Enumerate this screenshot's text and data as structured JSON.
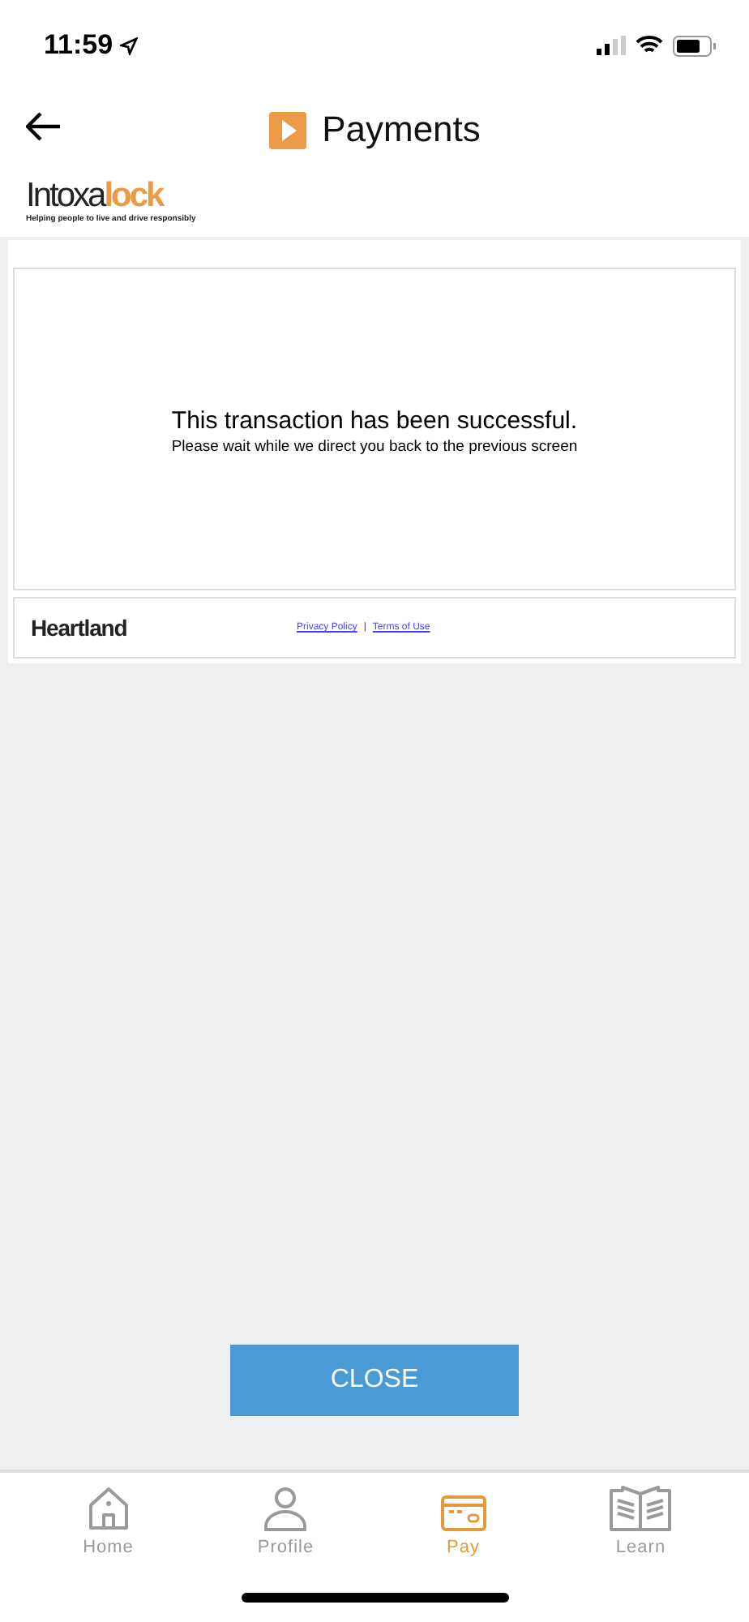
{
  "status_bar": {
    "time": "11:59"
  },
  "header": {
    "title": "Payments"
  },
  "brand": {
    "name_dark": "Intoxa",
    "name_accent": "lock",
    "tagline": "Helping people to live and drive responsibly"
  },
  "payment_frame": {
    "message": "This transaction has been successful.",
    "submessage": "Please wait while we direct you back to the previous screen",
    "provider": "Heartland",
    "links": [
      "Privacy Policy",
      "Terms of Use"
    ],
    "separator": "|"
  },
  "close_button": "CLOSE",
  "tabs": [
    {
      "label": "Home",
      "kind": "home",
      "selected": false
    },
    {
      "label": "Profile",
      "kind": "profile",
      "selected": false
    },
    {
      "label": "Pay",
      "kind": "pay",
      "selected": true
    },
    {
      "label": "Learn",
      "kind": "learn",
      "selected": false
    }
  ]
}
